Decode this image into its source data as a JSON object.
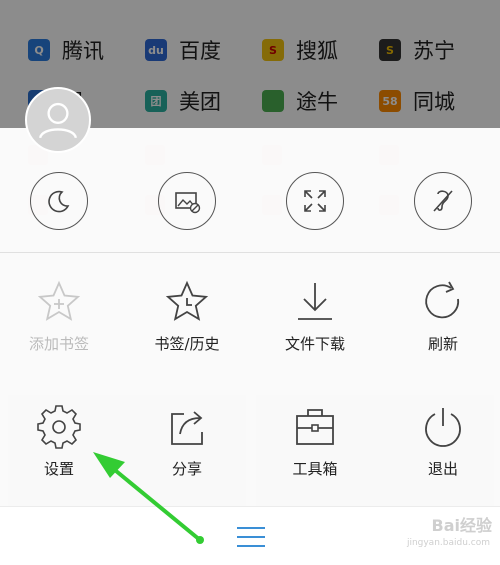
{
  "sites": {
    "row1": [
      {
        "label": "腾讯",
        "icon": "tencent-icon",
        "color": "#2a7de1",
        "glyph": "Q"
      },
      {
        "label": "百度",
        "icon": "baidu-icon",
        "color": "#2f6bd8",
        "glyph": "du"
      },
      {
        "label": "搜狐",
        "icon": "sohu-icon",
        "color": "#f2c40f",
        "glyph": "S"
      },
      {
        "label": "苏宁",
        "icon": "suning-icon",
        "color": "#333333",
        "glyph": "S"
      }
    ],
    "row2": [
      {
        "label": "程",
        "icon": "ctrip-icon",
        "color": "#2a6fd0",
        "glyph": ""
      },
      {
        "label": "美团",
        "icon": "meituan-icon",
        "color": "#2ab1a0",
        "glyph": "团"
      },
      {
        "label": "途牛",
        "icon": "tuniu-icon",
        "color": "#4caf50",
        "glyph": ""
      },
      {
        "label": "同城",
        "icon": "tongcheng-icon",
        "color": "#ff8a00",
        "glyph": "58"
      }
    ]
  },
  "menu": {
    "row1": [
      {
        "label": "添加书签",
        "icon": "add-bookmark-icon",
        "disabled": true
      },
      {
        "label": "书签/历史",
        "icon": "bookmark-history-icon",
        "disabled": false
      },
      {
        "label": "文件下载",
        "icon": "download-icon",
        "disabled": false
      },
      {
        "label": "刷新",
        "icon": "refresh-icon",
        "disabled": false
      }
    ],
    "row2": [
      {
        "label": "设置",
        "icon": "settings-icon",
        "disabled": false
      },
      {
        "label": "分享",
        "icon": "share-icon",
        "disabled": false
      },
      {
        "label": "工具箱",
        "icon": "toolbox-icon",
        "disabled": false
      },
      {
        "label": "退出",
        "icon": "power-icon",
        "disabled": false
      }
    ]
  },
  "toggles": [
    "night-mode-icon",
    "no-image-icon",
    "fullscreen-icon",
    "incognito-icon"
  ],
  "watermark": {
    "main": "Bai经验",
    "sub": "jingyan.baidu.com"
  },
  "colors": {
    "accent": "#3a8fd6",
    "arrow": "#33cc33"
  }
}
